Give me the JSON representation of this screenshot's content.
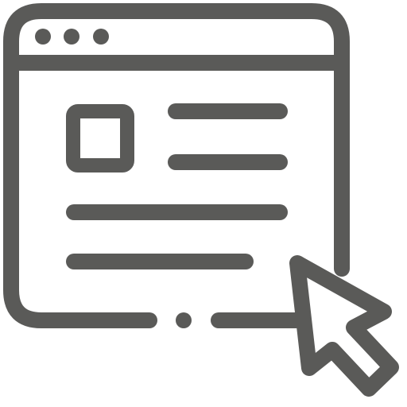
{
  "icon": {
    "name": "web-page-cursor-icon",
    "stroke_color": "#5a5a58",
    "background_color": "#ffffff"
  }
}
